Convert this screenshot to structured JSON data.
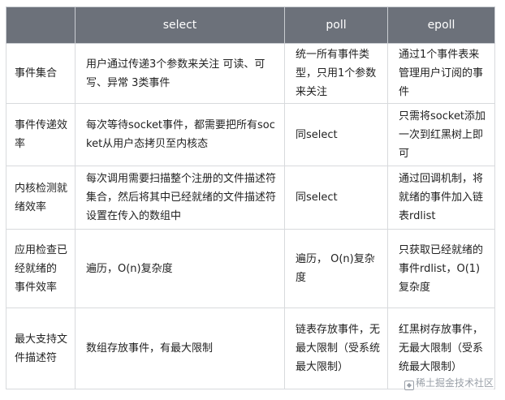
{
  "headers": [
    "",
    "select",
    "poll",
    "epoll"
  ],
  "rows": [
    {
      "label": "事件集合",
      "select": "用户通过传递3个参数来关注 可读、可写、异常 3类事件",
      "poll": "统一所有事件类型，只用1个参数来关注",
      "epoll": "通过1个事件表来管理用户订阅的事件"
    },
    {
      "label": "事件传递效率",
      "select": "每次等待socket事件，都需要把所有socket从用户态拷贝至内核态",
      "poll": "同select",
      "epoll": "只需将socket添加一次到红黑树上即可"
    },
    {
      "label": "内核检测就绪效率",
      "select": "每次调用需要扫描整个注册的文件描述符集合，然后将其中已经就绪的文件描述符设置在传入的数组中",
      "poll": "同select",
      "epoll": "通过回调机制，将就绪的事件加入链表rdlist"
    },
    {
      "label": "应用检查已经就绪的 事件效率",
      "select": "遍历，O(n)复杂度",
      "poll": "遍历， O(n)复杂度",
      "epoll": "只获取已经就绪的事件rdlist，O(1)复杂度"
    },
    {
      "label": "最大支持文件描述符",
      "select": "数组存放事件，有最大限制",
      "poll": "链表存放事件，无最大限制（受系统最大限制）",
      "epoll": "红黑树存放事件，无最大限制（受系统最大限制）"
    }
  ],
  "watermark": {
    "text": "稀土掘金技术社区",
    "icon": "juejin-logo-icon"
  }
}
